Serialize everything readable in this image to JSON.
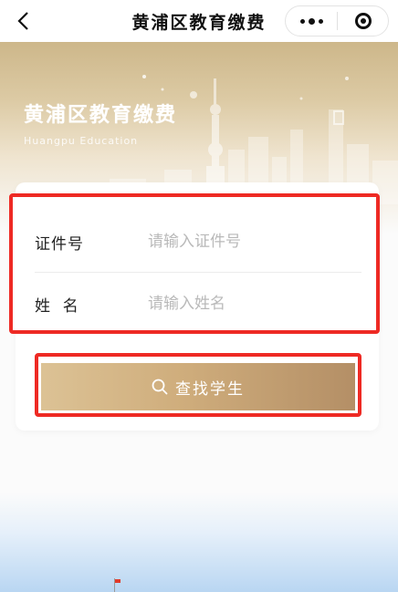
{
  "nav": {
    "title": "黄浦区教育缴费",
    "back_icon": "chevron-left-icon",
    "more_icon": "more-dots-icon",
    "close_icon": "miniprogram-close-icon"
  },
  "banner": {
    "title": "黄浦区教育缴费",
    "subtitle": "Huangpu Education"
  },
  "form": {
    "id_label": "证件号",
    "id_placeholder": "请输入证件号",
    "name_label": "姓  名",
    "name_placeholder": "请输入姓名"
  },
  "search_button": {
    "label": "查找学生",
    "icon": "search-icon"
  },
  "colors": {
    "highlight": "#ee2a24",
    "button_gradient_start": "#dcc295",
    "button_gradient_end": "#b48f66",
    "banner_gold": "#cdb78a"
  }
}
